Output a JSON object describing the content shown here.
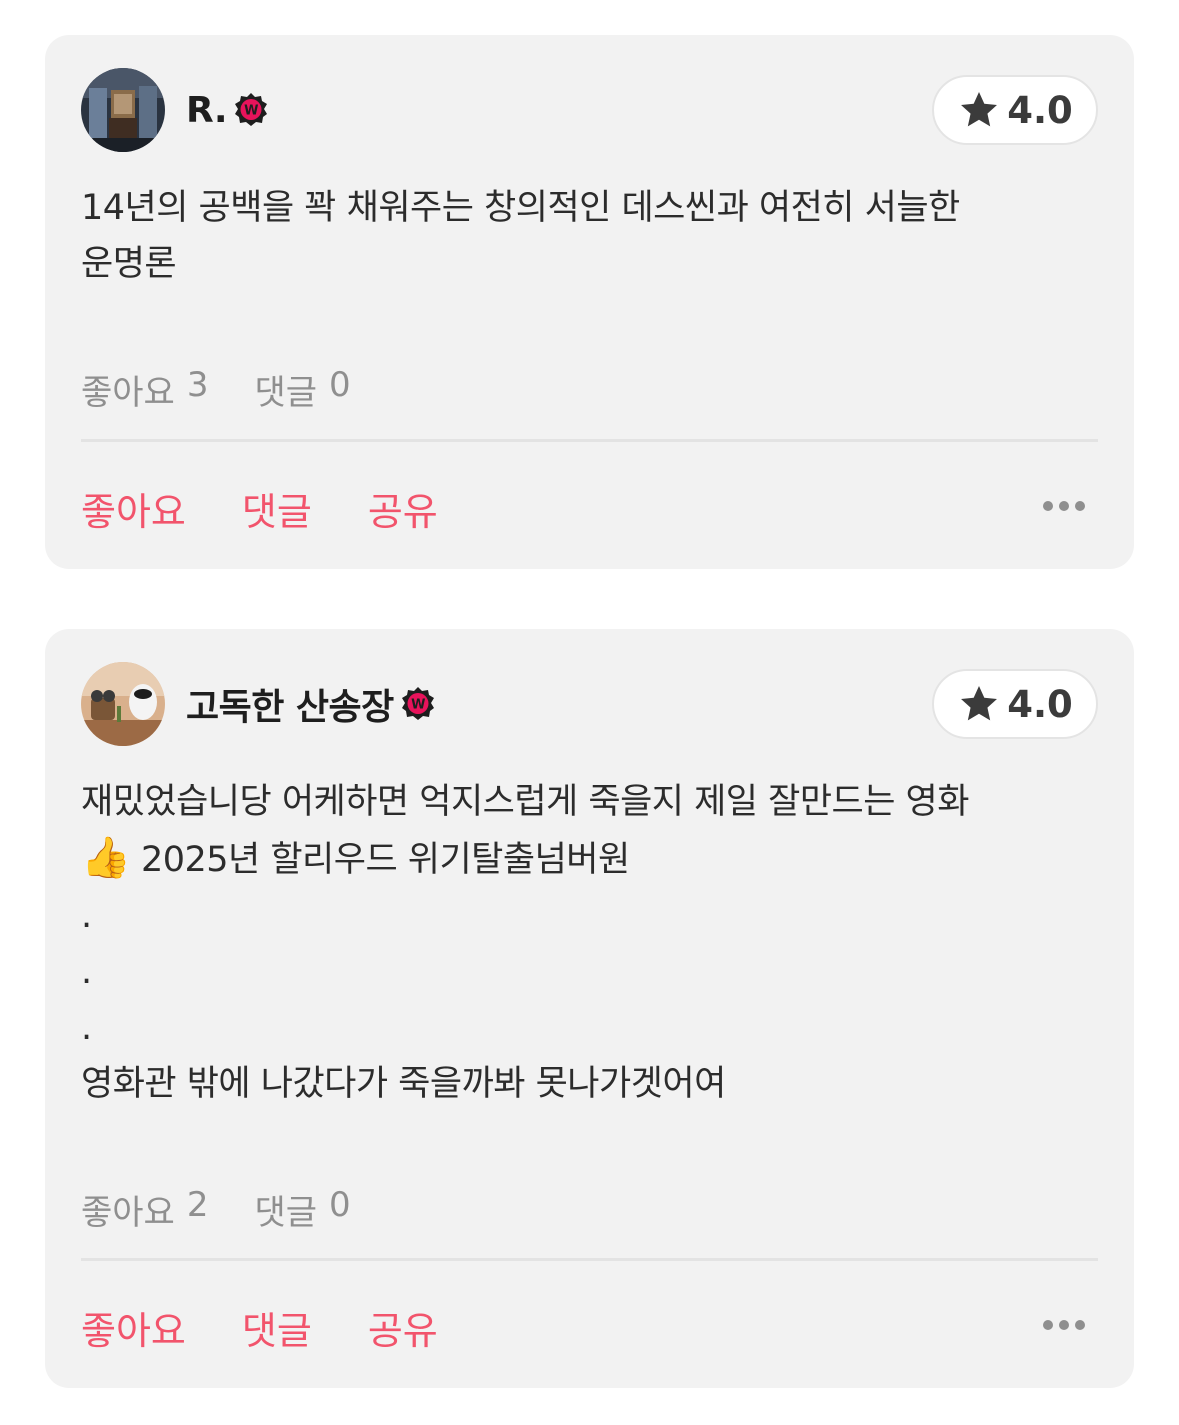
{
  "reviews": [
    {
      "username": "R.",
      "badge_letter": "W",
      "rating": "4.0",
      "lines": [
        "14년의 공백을 꽉 채워주는 창의적인 데스씬과 여전히 서늘한",
        "운명론"
      ],
      "likes_label": "좋아요",
      "likes_count": "3",
      "comments_label": "댓글",
      "comments_count": "0",
      "actions": {
        "like": "좋아요",
        "comment": "댓글",
        "share": "공유"
      }
    },
    {
      "username": "고독한 산송장",
      "badge_letter": "W",
      "rating": "4.0",
      "lines": [
        "재밌었습니당 어케하면 억지스럽게 죽을지 제일 잘만드는 영화",
        "2025년 할리우드 위기탈출넘버원",
        ".",
        ".",
        ".",
        "영화관 밖에 나갔다가 죽을까봐 못나가겟어여"
      ],
      "emoji": "👍",
      "likes_label": "좋아요",
      "likes_count": "2",
      "comments_label": "댓글",
      "comments_count": "0",
      "actions": {
        "like": "좋아요",
        "comment": "댓글",
        "share": "공유"
      }
    }
  ],
  "colors": {
    "card_bg": "#f2f2f2",
    "accent": "#f2546c",
    "badge_red": "#e8135b",
    "badge_dark": "#1e1e1e",
    "muted": "#8f8f8f",
    "text": "#2c2c2c"
  },
  "icons": {
    "rating": "star-icon",
    "badge": "watcha-badge-icon",
    "more": "more-dots-icon"
  }
}
